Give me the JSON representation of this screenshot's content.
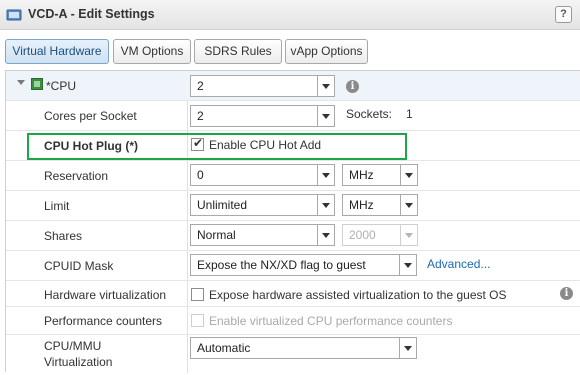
{
  "window": {
    "title": "VCD-A - Edit Settings",
    "help_label": "?"
  },
  "tabs": [
    {
      "label": "Virtual Hardware",
      "active": true
    },
    {
      "label": "VM Options",
      "active": false
    },
    {
      "label": "SDRS Rules",
      "active": false
    },
    {
      "label": "vApp Options",
      "active": false
    }
  ],
  "cpu": {
    "label": "*CPU",
    "value": "2"
  },
  "cores_per_socket": {
    "label": "Cores per Socket",
    "value": "2",
    "sockets_label": "Sockets:",
    "sockets_value": "1"
  },
  "cpu_hot_plug": {
    "label": "CPU Hot Plug (*)",
    "checkbox_label": "Enable CPU Hot Add",
    "checked": true
  },
  "reservation": {
    "label": "Reservation",
    "value": "0",
    "unit": "MHz"
  },
  "limit": {
    "label": "Limit",
    "value": "Unlimited",
    "unit": "MHz"
  },
  "shares": {
    "label": "Shares",
    "value": "Normal",
    "amount": "2000"
  },
  "cpuid_mask": {
    "label": "CPUID Mask",
    "value": "Expose the NX/XD flag to guest",
    "advanced_link": "Advanced..."
  },
  "hardware_virtualization": {
    "label": "Hardware virtualization",
    "checkbox_label": "Expose hardware assisted virtualization to the guest OS",
    "checked": false
  },
  "performance_counters": {
    "label": "Performance counters",
    "checkbox_label": "Enable virtualized CPU performance counters",
    "checked": false
  },
  "cpu_mmu": {
    "label_line1": "CPU/MMU",
    "label_line2": "Virtualization",
    "value": "Automatic"
  },
  "colors": {
    "highlight_box": "#1ea54a",
    "link": "#1a6bb0"
  }
}
